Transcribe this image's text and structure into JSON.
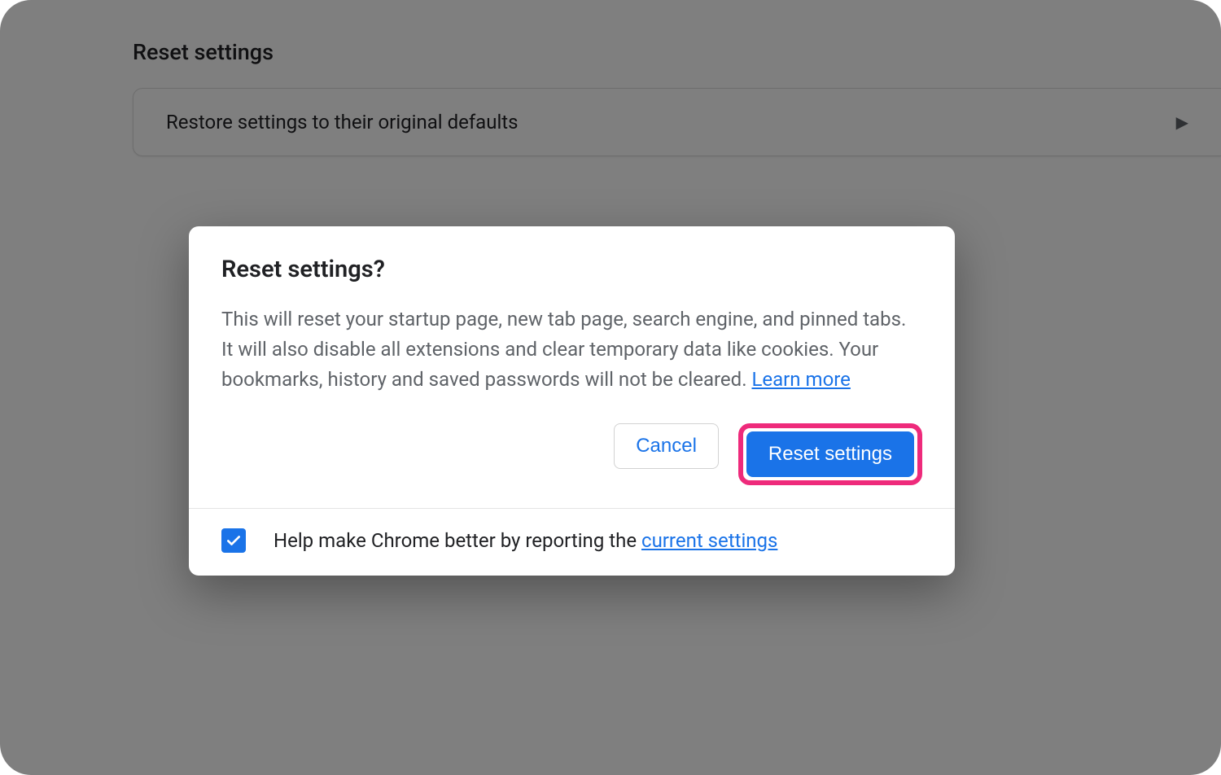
{
  "page": {
    "section_title": "Reset settings",
    "restore_row": {
      "label": "Restore settings to their original defaults"
    }
  },
  "dialog": {
    "title": "Reset settings?",
    "description": "This will reset your startup page, new tab page, search engine, and pinned tabs. It will also disable all extensions and clear temporary data like cookies. Your bookmarks, history and saved passwords will not be cleared. ",
    "learn_more": "Learn more",
    "cancel": "Cancel",
    "confirm": "Reset settings",
    "footer_prefix": "Help make Chrome better by reporting the ",
    "footer_link": "current settings",
    "checkbox_checked": true,
    "highlighted_button": "confirm"
  },
  "colors": {
    "accent": "#1a73e8",
    "highlight": "#ee2a7b"
  }
}
